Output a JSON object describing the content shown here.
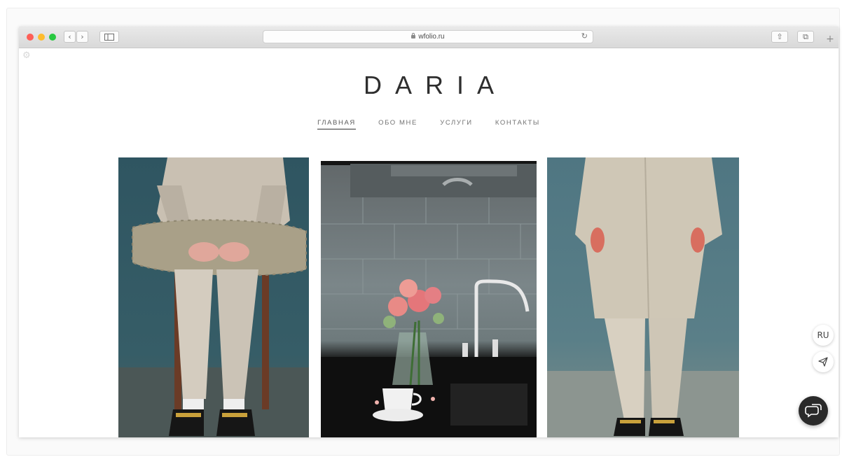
{
  "browser": {
    "url": "wfolio.ru",
    "back_glyph": "‹",
    "forward_glyph": "›",
    "reload_glyph": "↻",
    "share_glyph": "⇧",
    "tabs_glyph": "⧉",
    "new_tab_glyph": "+"
  },
  "site": {
    "logo": "DARIA",
    "nav": [
      {
        "label": "ГЛАВНАЯ",
        "active": true
      },
      {
        "label": "ОБО МНЕ",
        "active": false
      },
      {
        "label": "УСЛУГИ",
        "active": false
      },
      {
        "label": "КОНТАКТЫ",
        "active": false
      }
    ]
  },
  "widgets": {
    "language": "RU",
    "send_icon": "paper-plane-icon",
    "chat_icon": "chat-bubbles-icon",
    "settings_icon": "gear-icon"
  },
  "gallery": [
    {
      "subject": "person seated holding bag"
    },
    {
      "subject": "pink roses in vase by kitchen sink"
    },
    {
      "subject": "person standing in beige coat"
    }
  ],
  "colors": {
    "close": "#fe5f57",
    "minimize": "#febc2e",
    "zoom": "#28c840",
    "text": "#2e2e2e",
    "chat_button": "#2a2a2a"
  }
}
